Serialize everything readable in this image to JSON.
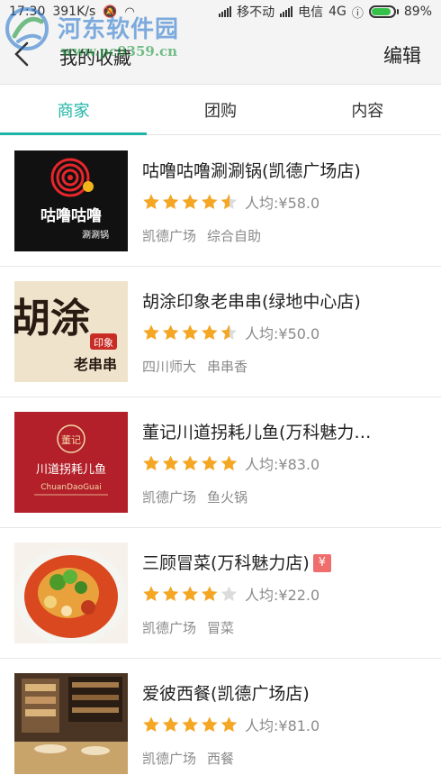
{
  "status_bar": {
    "time": "17:30",
    "speed": "391K/s",
    "carrier1": "移不动",
    "carrier2": "电信",
    "network": "4G",
    "battery": "89%",
    "battery_level": 0.89
  },
  "watermark": {
    "text": "河东软件园",
    "url": "www.pc0359.cn"
  },
  "header": {
    "title": "我的收藏",
    "edit_label": "编辑"
  },
  "tabs": [
    {
      "label": "商家",
      "active": true
    },
    {
      "label": "团购",
      "active": false
    },
    {
      "label": "内容",
      "active": false
    }
  ],
  "colors": {
    "accent": "#1fb5a6",
    "star": "#f5a623",
    "star_empty": "#dcdcdc",
    "tuan_badge": "#f06d6d"
  },
  "items": [
    {
      "name": "咕噜咕噜涮涮锅(凯德广场店)",
      "rating": 4.5,
      "price": "人均:¥58.0",
      "area": "凯德广场",
      "category": "综合自助",
      "badge": "",
      "thumb_text": "咕噜咕噜",
      "thumb_sub": "涮涮锅"
    },
    {
      "name": "胡涂印象老串串(绿地中心店)",
      "rating": 4.5,
      "price": "人均:¥50.0",
      "area": "四川师大",
      "category": "串串香",
      "badge": "",
      "thumb_text": "胡涂",
      "thumb_sub": "老串串",
      "thumb_seal": "印象"
    },
    {
      "name": "董记川道拐耗儿鱼(万科魅力…",
      "rating": 5,
      "price": "人均:¥83.0",
      "area": "凯德广场",
      "category": "鱼火锅",
      "badge": "",
      "thumb_text": "川道拐耗儿鱼",
      "thumb_sub": "ChuanDaoGuai",
      "thumb_seal": "董记"
    },
    {
      "name": "三顾冒菜(万科魅力店)",
      "rating": 4,
      "price": "人均:¥22.0",
      "area": "凯德广场",
      "category": "冒菜",
      "badge": "¥"
    },
    {
      "name": "爱彼西餐(凯德广场店)",
      "rating": 5,
      "price": "人均:¥81.0",
      "area": "凯德广场",
      "category": "西餐",
      "badge": ""
    }
  ]
}
